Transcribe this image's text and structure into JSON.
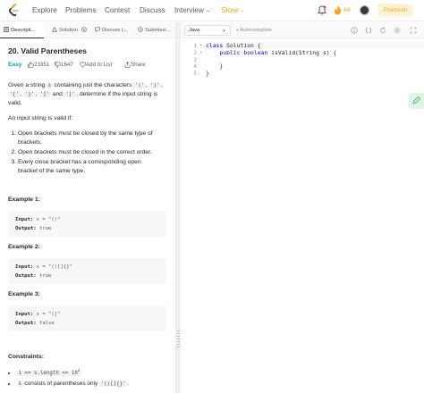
{
  "nav": {
    "items": [
      "Explore",
      "Problems",
      "Contest",
      "Discuss",
      "Interview",
      "Store"
    ],
    "streak_count": "64",
    "premium_label": "Premium",
    "store_color": "#ffa116"
  },
  "left_tabs": [
    "Descripti...",
    "Solution",
    "Discuss (...",
    "Submissi..."
  ],
  "problem": {
    "title": "20. Valid Parentheses",
    "difficulty": "Easy",
    "difficulty_color": "#00af9b",
    "likes": "23351",
    "dislikes": "1647",
    "add_to_list": "Add to List",
    "share": "Share",
    "intro": {
      "t1": "Given a string ",
      "s": "s",
      "t2": " containing just the characters ",
      "c1": "'('",
      "sep1": ", ",
      "c2": "')'",
      "sep2": ", ",
      "c3": "'{'",
      "sep3": ", ",
      "c4": "'}'",
      "sep4": ", ",
      "c5": "'['",
      "sep5": " and ",
      "c6": "']'",
      "t3": ", determine if the input string is valid."
    },
    "valid_intro": "An input string is valid if:",
    "rules": [
      "Open brackets must be closed by the same type of brackets.",
      "Open brackets must be closed in the correct order.",
      "Every close bracket has a corresponding open bracket of the same type."
    ],
    "examples": [
      {
        "heading": "Example 1:",
        "input_label": "Input:",
        "input": " s = \"()\"",
        "output_label": "Output:",
        "output": " true"
      },
      {
        "heading": "Example 2:",
        "input_label": "Input:",
        "input": " s = \"()[]{}\"",
        "output_label": "Output:",
        "output": " true"
      },
      {
        "heading": "Example 3:",
        "input_label": "Input:",
        "input": " s = \"(]\"",
        "output_label": "Output:",
        "output": " false"
      }
    ],
    "constraints_heading": "Constraints:",
    "constraint1": {
      "expr": "1 <= s.length <= 10",
      "exp": "4"
    },
    "constraint2": {
      "s": "s",
      "text": " consists of parentheses only ",
      "chars": "'()[]{}'",
      "end": "."
    }
  },
  "editor": {
    "language": "Java",
    "autocomplete": "Autocomplete",
    "line_numbers": [
      "1",
      "2",
      "3",
      "4",
      "5"
    ],
    "code": {
      "l1_kw": "class",
      "l1_rest": " Solution {",
      "l2_kw1": "public",
      "l2_kw2": "boolean",
      "l2_rest": " isValid(String s) {",
      "l4": "    }",
      "l5": "}"
    },
    "keyword_color": "#0000ff"
  }
}
